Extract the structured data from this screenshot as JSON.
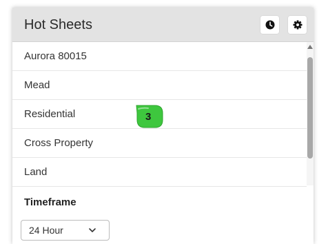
{
  "panel": {
    "title": "Hot Sheets",
    "icons": {
      "history": "clock-icon",
      "settings": "gear-icon"
    }
  },
  "list": {
    "items": [
      {
        "label": "Aurora 80015"
      },
      {
        "label": "Mead"
      },
      {
        "label": "Residential"
      },
      {
        "label": "Cross Property"
      },
      {
        "label": "Land"
      }
    ]
  },
  "timeframe": {
    "label": "Timeframe",
    "selected": "24 Hour",
    "icon": "chevron-down-icon"
  },
  "annotation": {
    "number": "3",
    "color": "#3ec73e"
  }
}
